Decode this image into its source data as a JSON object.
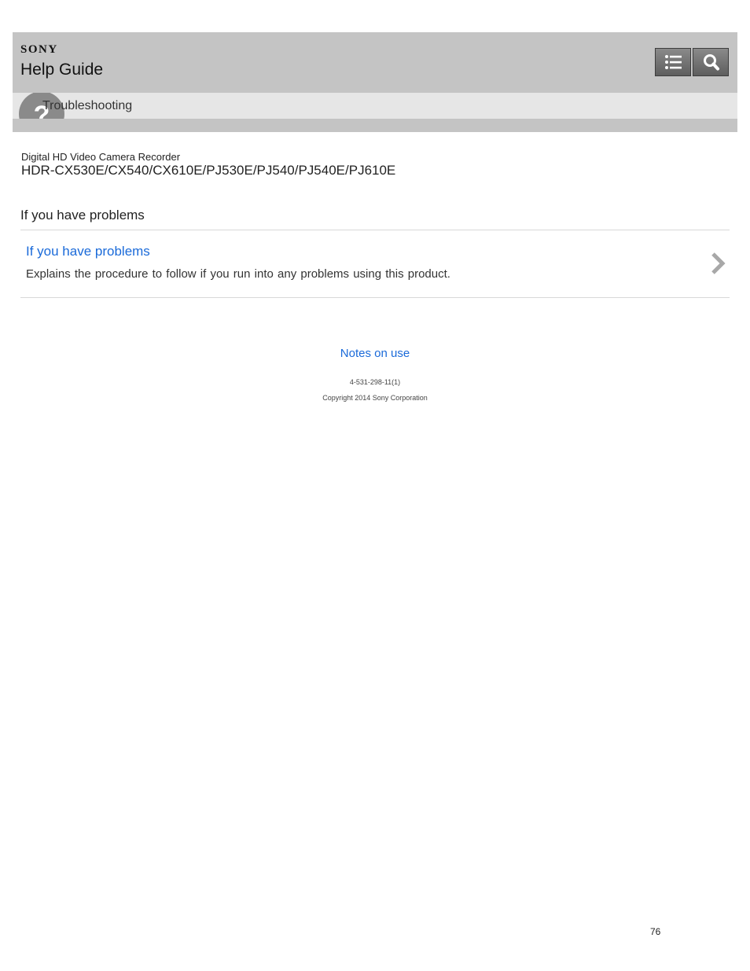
{
  "header": {
    "brand": "SONY",
    "title": "Help Guide",
    "toc_icon": "list-icon",
    "search_icon": "search-icon"
  },
  "category": {
    "icon": "question-mark-icon",
    "label": "Troubleshooting"
  },
  "product": {
    "type": "Digital HD Video Camera Recorder",
    "models": "HDR-CX530E/CX540/CX610E/PJ530E/PJ540/PJ540E/PJ610E"
  },
  "page": {
    "heading": "If you have problems",
    "entries": [
      {
        "title": "If you have problems",
        "description": "Explains the procedure to follow if you run into any problems using this product.",
        "icon": "chevron-right-icon"
      }
    ]
  },
  "footer": {
    "notes_link": "Notes on use",
    "doc_number": "4-531-298-11(1)",
    "copyright": "Copyright 2014 Sony Corporation",
    "page_number": "76"
  },
  "colors": {
    "header_bg": "#c4c4c4",
    "category_bg": "#e6e6e6",
    "link": "#1a6ad9",
    "button_bg": "#6e6e6e"
  }
}
